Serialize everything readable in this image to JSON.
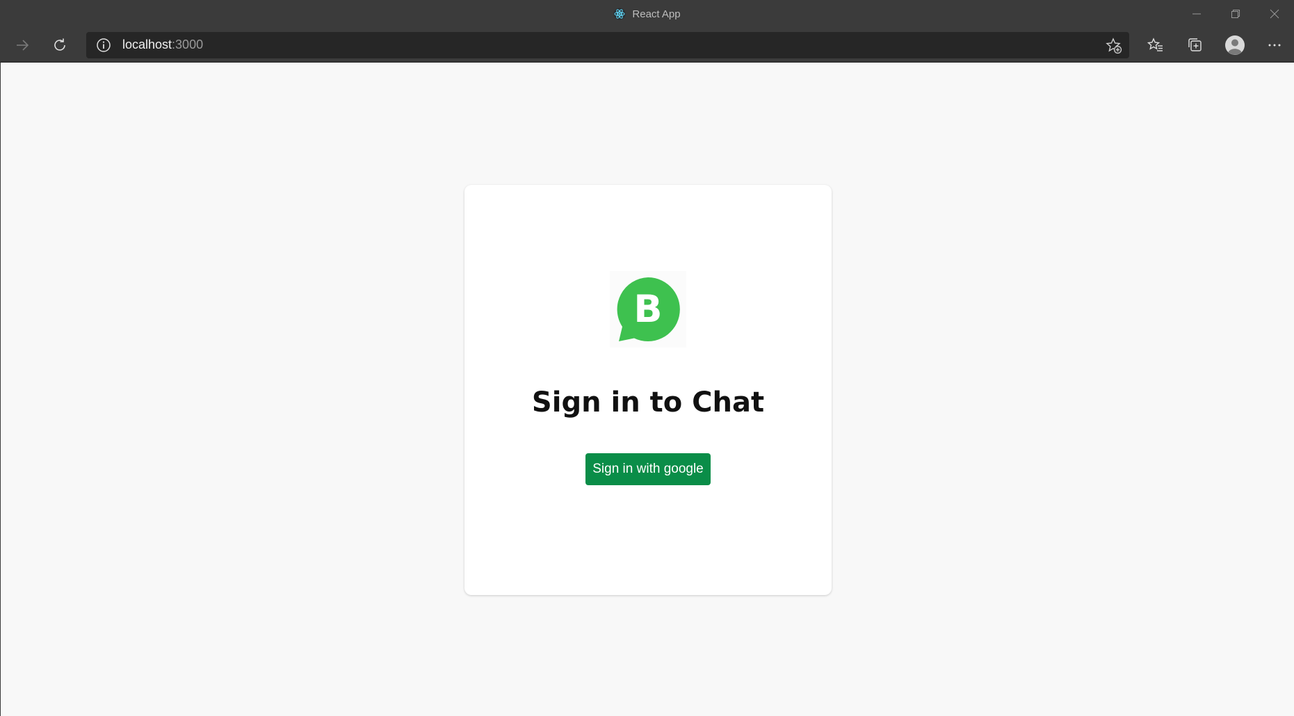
{
  "window": {
    "title": "React App",
    "controls": [
      "minimize-icon",
      "restore-icon",
      "close-icon"
    ]
  },
  "toolbar": {
    "url_host": "localhost",
    "url_port": ":3000",
    "icons": [
      "forward-icon",
      "refresh-icon",
      "site-info-icon",
      "add-favorite-icon",
      "favorites-icon",
      "collections-icon",
      "profile-icon",
      "more-icon"
    ]
  },
  "login": {
    "logo_letter": "B",
    "title": "Sign in to Chat",
    "button_label": "Sign in with google"
  },
  "colors": {
    "chrome": "#3b3b3b",
    "page_bg": "#f8f8f8",
    "logo_green": "#3ec14f",
    "button_green": "#0a8d48"
  }
}
